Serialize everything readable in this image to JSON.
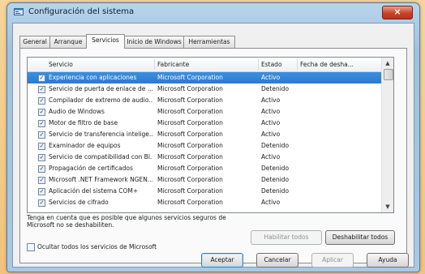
{
  "window": {
    "title": "Configuración del sistema",
    "close_glyph": "×"
  },
  "tabs": [
    {
      "label": "General"
    },
    {
      "label": "Arranque"
    },
    {
      "label": "Servicios"
    },
    {
      "label": "Inicio de Windows"
    },
    {
      "label": "Herramientas"
    }
  ],
  "active_tab": "Servicios",
  "columns": {
    "service": "Servicio",
    "maker": "Fabricante",
    "state": "Estado",
    "disabled_date": "Fecha de desha..."
  },
  "services": [
    {
      "name": "Experiencia con aplicaciones",
      "maker": "Microsoft Corporation",
      "state": "Activo",
      "checked": true,
      "selected": true
    },
    {
      "name": "Servicio de puerta de enlace de ...",
      "maker": "Microsoft Corporation",
      "state": "Detenido",
      "checked": true
    },
    {
      "name": "Compilador de extremo de audio...",
      "maker": "Microsoft Corporation",
      "state": "Activo",
      "checked": true
    },
    {
      "name": "Audio de Windows",
      "maker": "Microsoft Corporation",
      "state": "Activo",
      "checked": true
    },
    {
      "name": "Motor de filtro de base",
      "maker": "Microsoft Corporation",
      "state": "Activo",
      "checked": true
    },
    {
      "name": "Servicio de transferencia intelige...",
      "maker": "Microsoft Corporation",
      "state": "Activo",
      "checked": true
    },
    {
      "name": "Examinador de equipos",
      "maker": "Microsoft Corporation",
      "state": "Detenido",
      "checked": true
    },
    {
      "name": "Servicio de compatibilidad con Bl...",
      "maker": "Microsoft Corporation",
      "state": "Activo",
      "checked": true
    },
    {
      "name": "Propagación de certificados",
      "maker": "Microsoft Corporation",
      "state": "Detenido",
      "checked": true
    },
    {
      "name": "Microsoft .NET Framework NGEN...",
      "maker": "Microsoft Corporation",
      "state": "Detenido",
      "checked": true
    },
    {
      "name": "Aplicación del sistema COM+",
      "maker": "Microsoft Corporation",
      "state": "Detenido",
      "checked": true
    },
    {
      "name": "Servicios de cifrado",
      "maker": "Microsoft Corporation",
      "state": "Activo",
      "checked": true
    }
  ],
  "note": "Tenga en cuenta que es posible que algunos servicios seguros de Microsoft no se deshabiliten.",
  "buttons": {
    "enable_all": "Habilitar todos",
    "disable_all": "Deshabilitar todos",
    "ok": "Aceptar",
    "cancel": "Cancelar",
    "apply": "Aplicar",
    "help": "Ayuda"
  },
  "hide_ms_checkbox": {
    "label": "Ocultar todos los servicios de Microsoft",
    "checked": false
  },
  "scroll": {
    "up_glyph": "▲",
    "down_glyph": "▼"
  },
  "colors": {
    "selection": "#3b8fe0",
    "close_button": "#c9432a",
    "page_background": "#f3c98a"
  }
}
